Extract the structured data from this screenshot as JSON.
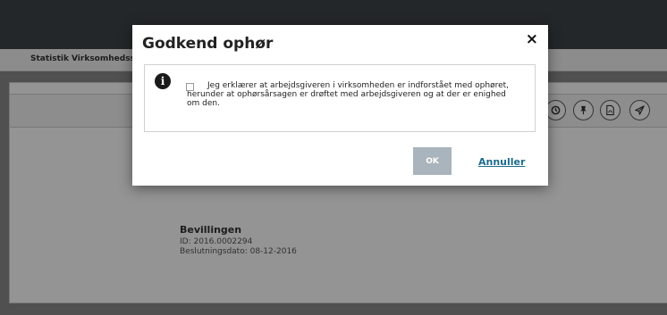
{
  "nav": {
    "items": [
      "Statistik",
      "Virksomhedssu"
    ]
  },
  "grant": {
    "title": "Bevillingen",
    "id_line": "ID: 2016.0002294",
    "date_line": "Beslutningsdato: 08-12-2016"
  },
  "toolbar": {
    "icons": [
      "history-icon",
      "pin-icon",
      "pdf-icon",
      "send-icon"
    ]
  },
  "modal": {
    "title": "Godkend ophør",
    "close_label": "×",
    "info_icon": "i",
    "confirm_text": "Jeg erklærer at arbejdsgiveren i virksomheden er indforstået med ophøret, herunder at ophørsårsagen er drøftet med arbejdsgiveren og at der er enighed om den.",
    "confirm_checked": false,
    "ok_label": "OK",
    "cancel_label": "Annuller"
  },
  "colors": {
    "topbar": "#3f4448",
    "ok_disabled": "#a9b4bd",
    "link": "#1e6b8e"
  }
}
